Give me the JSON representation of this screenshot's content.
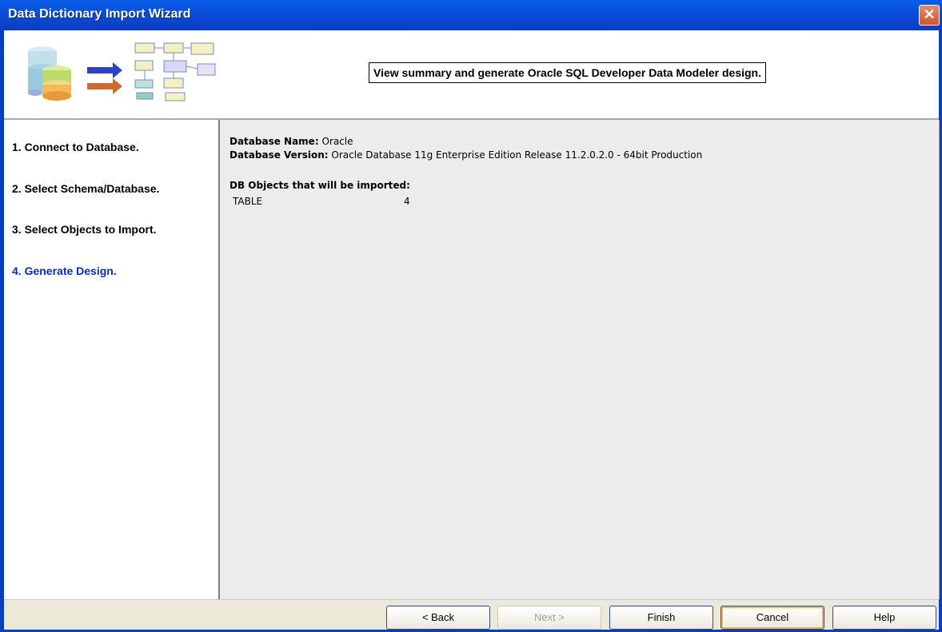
{
  "window": {
    "title": "Data Dictionary Import Wizard",
    "close_glyph": "✕"
  },
  "header": {
    "message": "View summary and generate Oracle SQL Developer Data Modeler design."
  },
  "steps": [
    {
      "label": "1. Connect to Database."
    },
    {
      "label": "2. Select Schema/Database."
    },
    {
      "label": "3. Select Objects to Import."
    },
    {
      "label": "4. Generate Design."
    }
  ],
  "summary": {
    "db_name_label": "Database Name:",
    "db_name_value": "Oracle",
    "db_version_label": "Database Version:",
    "db_version_value": "Oracle Database 11g Enterprise Edition Release 11.2.0.2.0 - 64bit Production",
    "objects_heading": "DB Objects that will be imported:",
    "objects": [
      {
        "type": "TABLE",
        "count": "4"
      }
    ]
  },
  "buttons": {
    "back": "< Back",
    "next": "Next >",
    "finish": "Finish",
    "cancel": "Cancel",
    "help": "Help"
  },
  "colors": {
    "active_step": "#0a24e6",
    "title_bar": "#0b49d4"
  }
}
